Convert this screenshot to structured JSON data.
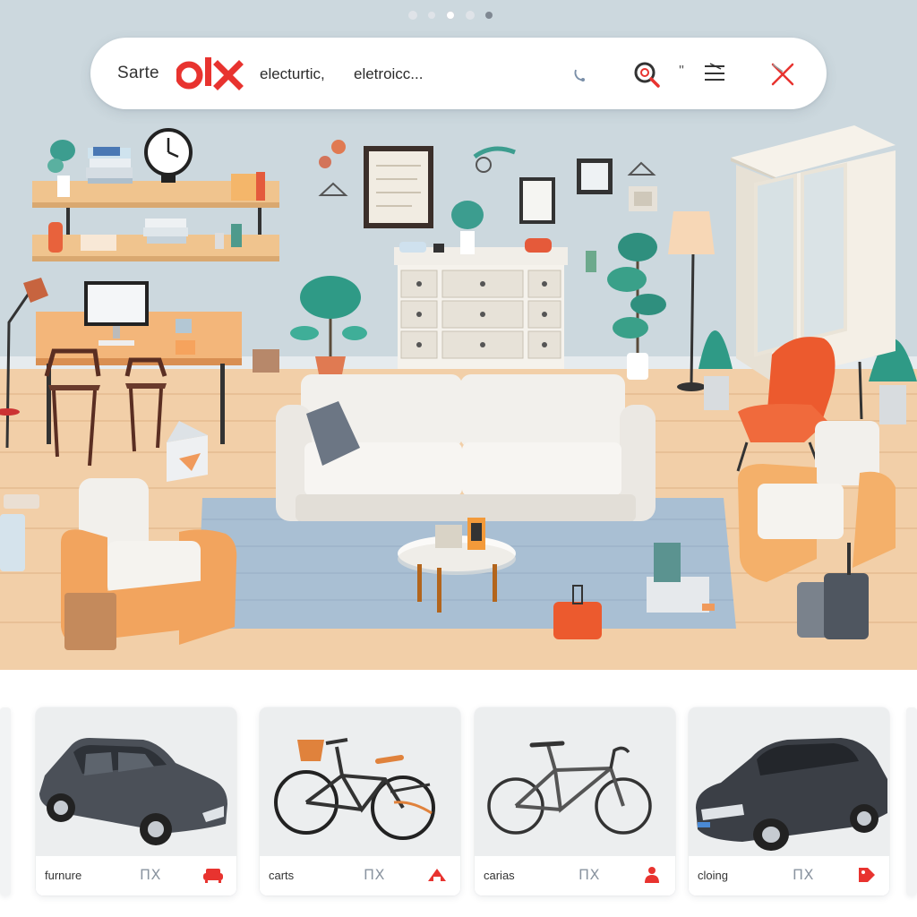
{
  "carousel": {
    "count": 5,
    "active": 2
  },
  "search": {
    "leading_text": "Sarte",
    "logo_text": "olx",
    "query_parts": [
      "electurtic,",
      "eletroicc..."
    ],
    "quote_glyph": "\"",
    "icons": [
      "microphone-icon",
      "search-icon",
      "filter-icon",
      "close-icon"
    ]
  },
  "categories": [
    {
      "label": "furnure",
      "mark": "ΠX",
      "icon": "sofa-icon",
      "image": "car"
    },
    {
      "label": "carts",
      "mark": "ΠX",
      "icon": "home-icon",
      "image": "bicycle"
    },
    {
      "label": "carias",
      "mark": "ΠX",
      "icon": "person-icon",
      "image": "road-bike"
    },
    {
      "label": "cloing",
      "mark": "ΠX",
      "icon": "tag-icon",
      "image": "sedan"
    }
  ],
  "colors": {
    "brand": "#e8332f",
    "wall": "#ccd8de",
    "floor": "#f2cfa8",
    "rug": "#a9bfd3"
  }
}
